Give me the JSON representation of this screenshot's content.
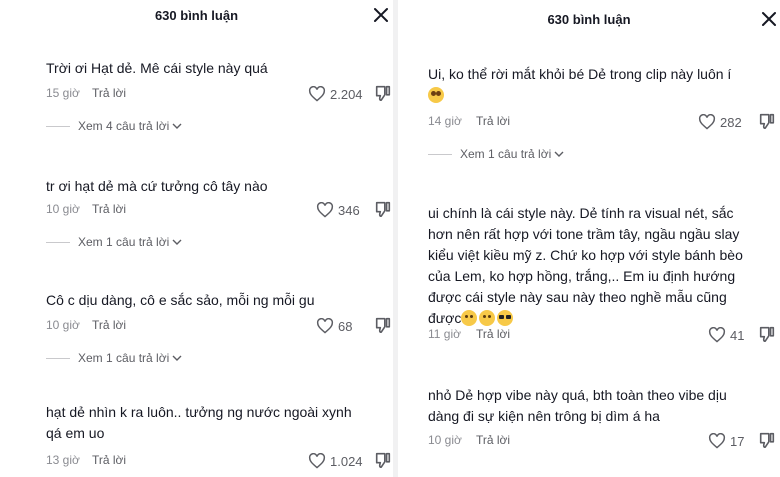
{
  "left": {
    "header_title": "630 bình luận",
    "comments": [
      {
        "text": "Trời ơi Hạt dẻ. Mê cái style này quá",
        "time": "15 giờ",
        "reply": "Trả lời",
        "likes": "2.204",
        "view_replies": "Xem 4 câu trả lời"
      },
      {
        "text": "tr ơi hạt dẻ mà cứ tưởng cô tây nào",
        "time": "10 giờ",
        "reply": "Trả lời",
        "likes": "346",
        "view_replies": "Xem 1 câu trả lời"
      },
      {
        "text": "Cô c dịu dàng, cô e sắc sảo, mỗi ng mỗi gu",
        "time": "10 giờ",
        "reply": "Trả lời",
        "likes": "68",
        "view_replies": "Xem 1 câu trả lời"
      },
      {
        "text": "hạt dẻ nhìn k ra luôn.. tưởng ng nước ngoài xynh\nqá em uo",
        "time": "13 giờ",
        "reply": "Trả lời",
        "likes": "1.024"
      }
    ]
  },
  "right": {
    "header_title": "630 bình luận",
    "comments": [
      {
        "text": "Ui, ko thể rời mắt khỏi bé Dẻ trong clip này luôn í",
        "emoji": [
          "pleading-face"
        ],
        "time": "14 giờ",
        "reply": "Trả lời",
        "likes": "282",
        "view_replies": "Xem 1 câu trả lời"
      },
      {
        "text": "ui chính là cái style này. Dẻ tính ra visual nét, sắc\nhơn nên rất hợp với tone trầm tây, ngầu ngầu slay\nkiểu việt kiều mỹ z. Chứ ko hợp với style bánh bèo\ncủa Lem, ko hợp hồng, trắng,.. Em iu định hướng\nđược cái style này sau này theo nghề mẫu cũng\nđược",
        "emoji": [
          "smiling-face",
          "smiling-face",
          "sunglasses-face"
        ],
        "time": "11 giờ",
        "reply": "Trả lời",
        "likes": "41"
      },
      {
        "text": "nhỏ Dẻ hợp vibe này quá, bth toàn theo vibe dịu\ndàng đi sự kiện nên trông bị dìm á ha",
        "time": "10 giờ",
        "reply": "Trả lời",
        "likes": "17"
      }
    ]
  }
}
